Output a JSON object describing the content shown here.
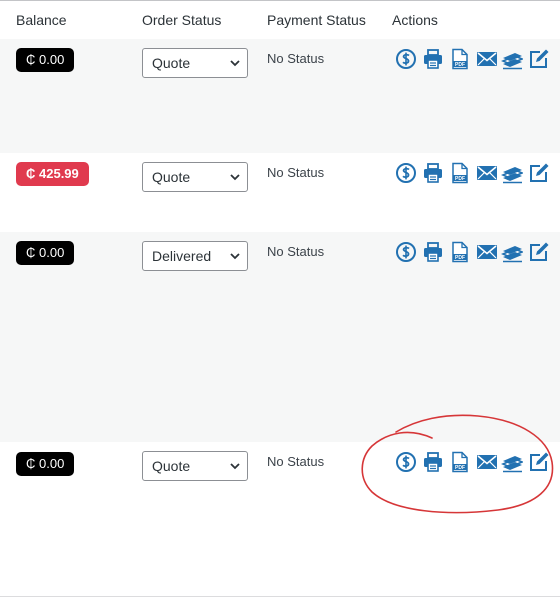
{
  "columns": {
    "balance": "Balance",
    "order_status": "Order Status",
    "payment_status": "Payment Status",
    "actions": "Actions"
  },
  "rows": [
    {
      "balance": "₵ 0.00",
      "balance_style": "black",
      "order_status": "Quote",
      "payment_status": "No Status"
    },
    {
      "balance": "₵ 425.99",
      "balance_style": "red",
      "order_status": "Quote",
      "payment_status": "No Status"
    },
    {
      "balance": "₵ 0.00",
      "balance_style": "black",
      "order_status": "Delivered",
      "payment_status": "No Status"
    },
    {
      "balance": "₵ 0.00",
      "balance_style": "black",
      "order_status": "Quote",
      "payment_status": "No Status"
    }
  ],
  "action_icons": [
    "payment-icon",
    "print-icon",
    "pdf-icon",
    "email-icon",
    "shipping-icon",
    "edit-icon"
  ],
  "colors": {
    "accent": "#2271b1",
    "badge_black": "#000000",
    "badge_red": "#e03a4e",
    "annotation": "#d63638",
    "row_alt": "#f6f7f7"
  }
}
